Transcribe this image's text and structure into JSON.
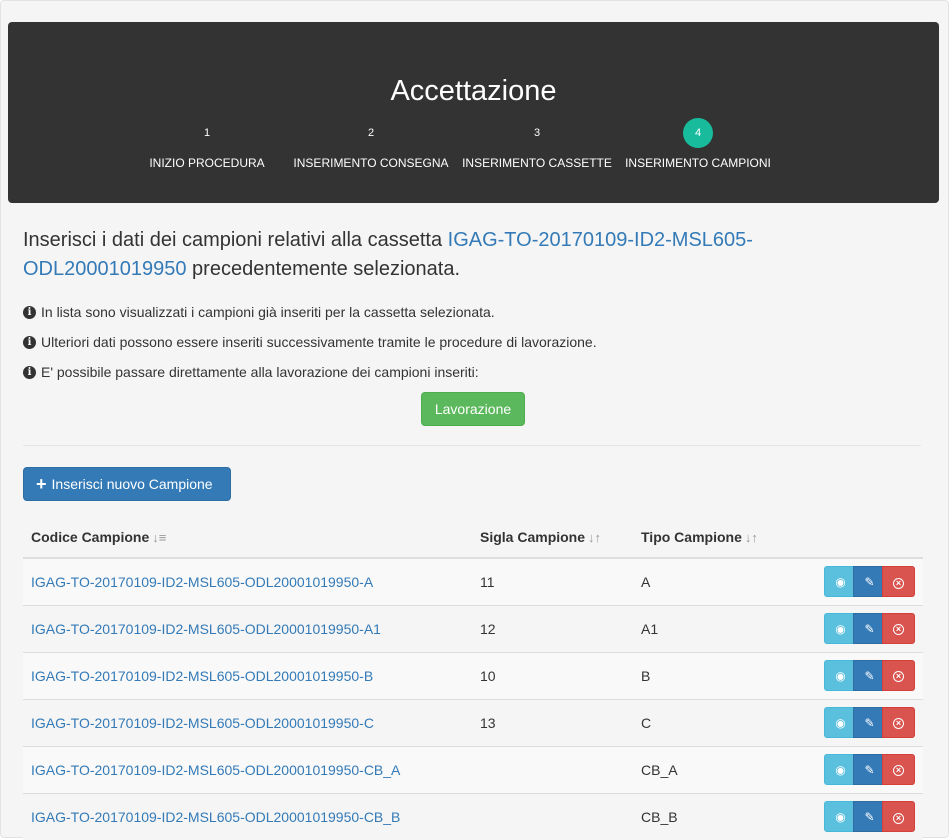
{
  "header": {
    "title": "Accettazione",
    "steps": [
      {
        "number": "1",
        "label": "INIZIO PROCEDURA",
        "active": false
      },
      {
        "number": "2",
        "label": "INSERIMENTO CONSEGNA",
        "active": false
      },
      {
        "number": "3",
        "label": "INSERIMENTO CASSETTE",
        "active": false
      },
      {
        "number": "4",
        "label": "INSERIMENTO CAMPIONI",
        "active": true
      }
    ]
  },
  "main": {
    "heading_prefix": "Inserisci i dati dei campioni relativi alla cassetta ",
    "heading_link": "IGAG-TO-20170109-ID2-MSL605-ODL20001019950",
    "heading_suffix": " precedentemente selezionata.",
    "info": [
      "In lista sono visualizzati i campioni già inseriti per la cassetta selezionata.",
      "Ulteriori dati possono essere inseriti successivamente tramite le procedure di lavorazione.",
      "E' possibile passare direttamente alla lavorazione dei campioni inseriti:"
    ],
    "lavorazione_button": "Lavorazione",
    "new_button": "Inserisci nuovo Campione"
  },
  "table": {
    "columns": [
      "Codice Campione",
      "Sigla Campione",
      "Tipo Campione"
    ],
    "rows": [
      {
        "codice": "IGAG-TO-20170109-ID2-MSL605-ODL20001019950-A",
        "sigla": "11",
        "tipo": "A"
      },
      {
        "codice": "IGAG-TO-20170109-ID2-MSL605-ODL20001019950-A1",
        "sigla": "12",
        "tipo": "A1"
      },
      {
        "codice": "IGAG-TO-20170109-ID2-MSL605-ODL20001019950-B",
        "sigla": "10",
        "tipo": "B"
      },
      {
        "codice": "IGAG-TO-20170109-ID2-MSL605-ODL20001019950-C",
        "sigla": "13",
        "tipo": "C"
      },
      {
        "codice": "IGAG-TO-20170109-ID2-MSL605-ODL20001019950-CB_A",
        "sigla": "",
        "tipo": "CB_A"
      },
      {
        "codice": "IGAG-TO-20170109-ID2-MSL605-ODL20001019950-CB_B",
        "sigla": "",
        "tipo": "CB_B"
      }
    ]
  },
  "colors": {
    "header_bg": "#333333",
    "active_step": "#18bc9c",
    "link": "#337ab7",
    "success": "#5cb85c",
    "info": "#5bc0de",
    "danger": "#d9534f"
  }
}
